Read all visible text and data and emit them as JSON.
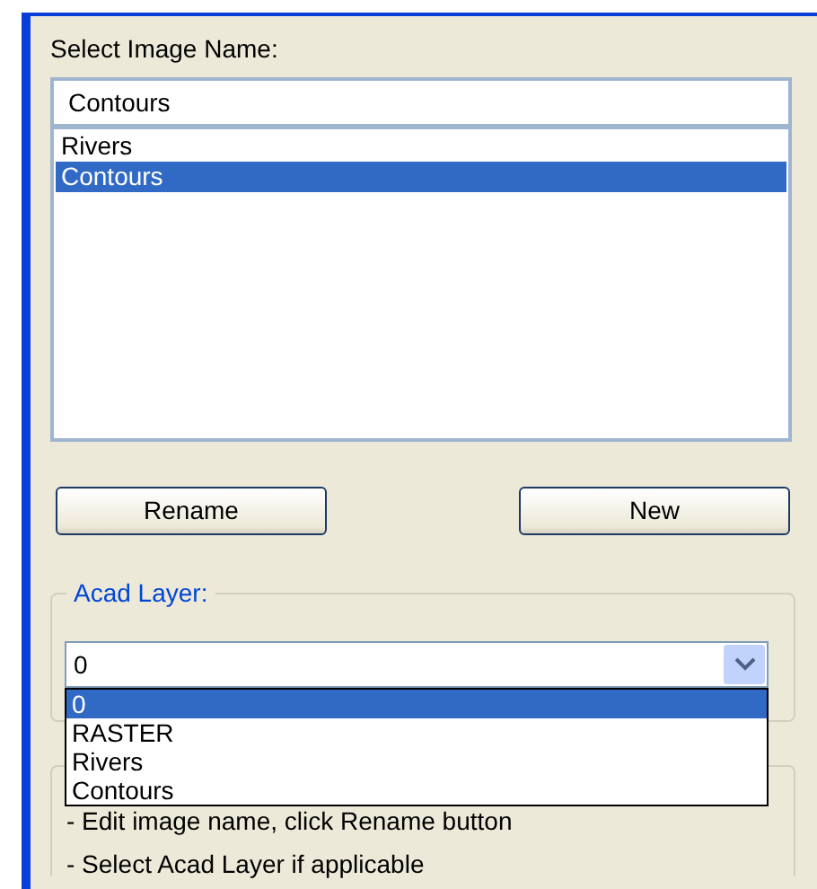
{
  "label": "Select Image Name:",
  "name_field": {
    "value": "Contours"
  },
  "images": [
    {
      "label": "Rivers",
      "selected": false
    },
    {
      "label": "Contours",
      "selected": true
    }
  ],
  "buttons": [
    "Rename",
    "New"
  ],
  "acad_layer": {
    "legend": "Acad Layer:",
    "value": "0",
    "expanded": true,
    "options": [
      {
        "label": "0",
        "selected": true
      },
      {
        "label": "RASTER",
        "selected": false
      },
      {
        "label": "Rivers",
        "selected": false
      },
      {
        "label": "Contours",
        "selected": false
      }
    ]
  },
  "instructions": [
    "- Edit image name, click Rename button",
    "- Select Acad Layer if applicable"
  ]
}
